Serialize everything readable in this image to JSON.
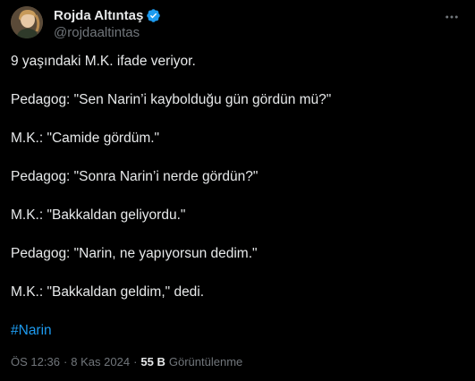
{
  "author": {
    "display_name": "Rojda Altıntaş",
    "handle": "@rojdaaltintas",
    "verified_icon": "verified-badge-icon",
    "more_icon": "more-options-icon"
  },
  "tweet": {
    "lines": [
      "9 yaşındaki M.K. ifade veriyor.",
      "Pedagog: \"Sen Narin’i kaybolduğu gün gördün mü?\"",
      "M.K.: \"Camide gördüm.\"",
      "Pedagog: \"Sonra Narin’i nerde gördün?\"",
      "M.K.: \"Bakkaldan geliyordu.\"",
      "Pedagog: \"Narin, ne yapıyorsun dedim.\"",
      "M.K.: \"Bakkaldan geldim,\" dedi."
    ],
    "hashtag": "#Narin"
  },
  "meta": {
    "time": "ÖS 12:36",
    "separator": "·",
    "date": "8 Kas 2024",
    "views_count": "55 B",
    "views_label": "Görüntülenme"
  },
  "colors": {
    "background": "#000000",
    "text": "#e7e9ea",
    "muted": "#71767b",
    "accent": "#1d9bf0"
  }
}
